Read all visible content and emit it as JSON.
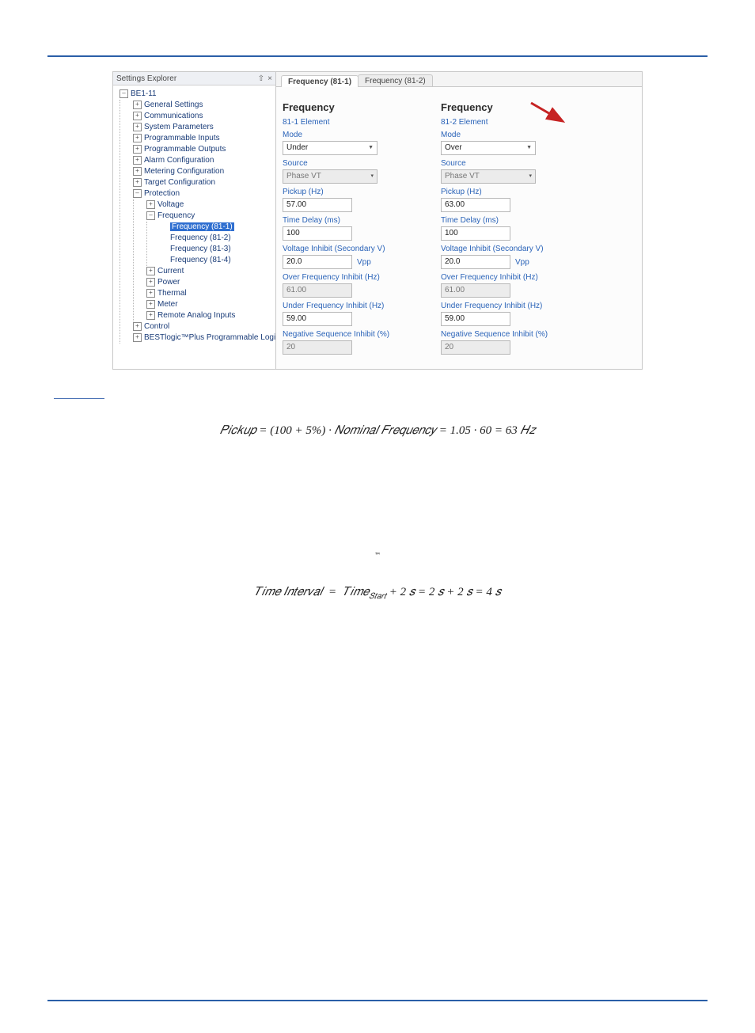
{
  "explorer": {
    "title": "Settings Explorer",
    "pin_icon": "⇧",
    "close_icon": "×",
    "root": "BE1-11",
    "items": {
      "general": "General Settings",
      "comm": "Communications",
      "sysparam": "System Parameters",
      "proginputs": "Programmable Inputs",
      "progoutputs": "Programmable Outputs",
      "alarmconfig": "Alarm Configuration",
      "metering": "Metering Configuration",
      "targetconfig": "Target Configuration",
      "protection": "Protection",
      "voltage": "Voltage",
      "frequency": "Frequency",
      "f81_1": "Frequency (81-1)",
      "f81_2": "Frequency (81-2)",
      "f81_3": "Frequency (81-3)",
      "f81_4": "Frequency (81-4)",
      "current": "Current",
      "power": "Power",
      "thermal": "Thermal",
      "meter": "Meter",
      "remoteanalog": "Remote Analog Inputs",
      "control": "Control",
      "bestlogic": "BESTlogic™Plus Programmable Logic"
    }
  },
  "tabs": {
    "t1": "Frequency (81-1)",
    "t2": "Frequency (81-2)"
  },
  "panel1": {
    "heading": "Frequency",
    "subtitle": "81-1 Element",
    "mode_label": "Mode",
    "mode_value": "Under",
    "source_label": "Source",
    "source_value": "Phase VT",
    "pickup_label": "Pickup (Hz)",
    "pickup_value": "57.00",
    "delay_label": "Time Delay (ms)",
    "delay_value": "100",
    "vinh_label": "Voltage Inhibit (Secondary V)",
    "vinh_value": "20.0",
    "vinh_unit": "Vpp",
    "ofinh_label": "Over Frequency Inhibit (Hz)",
    "ofinh_value": "61.00",
    "ufinh_label": "Under Frequency Inhibit (Hz)",
    "ufinh_value": "59.00",
    "neg_label": "Negative Sequence Inhibit (%)",
    "neg_value": "20"
  },
  "panel2": {
    "heading": "Frequency",
    "subtitle": "81-2 Element",
    "mode_label": "Mode",
    "mode_value": "Over",
    "source_label": "Source",
    "source_value": "Phase VT",
    "pickup_label": "Pickup (Hz)",
    "pickup_value": "63.00",
    "delay_label": "Time Delay (ms)",
    "delay_value": "100",
    "vinh_label": "Voltage Inhibit (Secondary V)",
    "vinh_value": "20.0",
    "vinh_unit": "Vpp",
    "ofinh_label": "Over Frequency Inhibit (Hz)",
    "ofinh_value": "61.00",
    "ufinh_label": "Under Frequency Inhibit (Hz)",
    "ufinh_value": "59.00",
    "neg_label": "Negative Sequence Inhibit (%)",
    "neg_value": "20"
  },
  "equations": {
    "pickup": "𝑃𝑖𝑐𝑘𝑢𝑝 = (100 + 5%) · 𝑁𝑜𝑚𝑖𝑛𝑎𝑙 𝐹𝑟𝑒𝑞𝑢𝑒𝑛𝑐𝑦 = 1.05 · 60 = 63 𝐻𝑧"
  },
  "text": {
    "tm": "™"
  }
}
